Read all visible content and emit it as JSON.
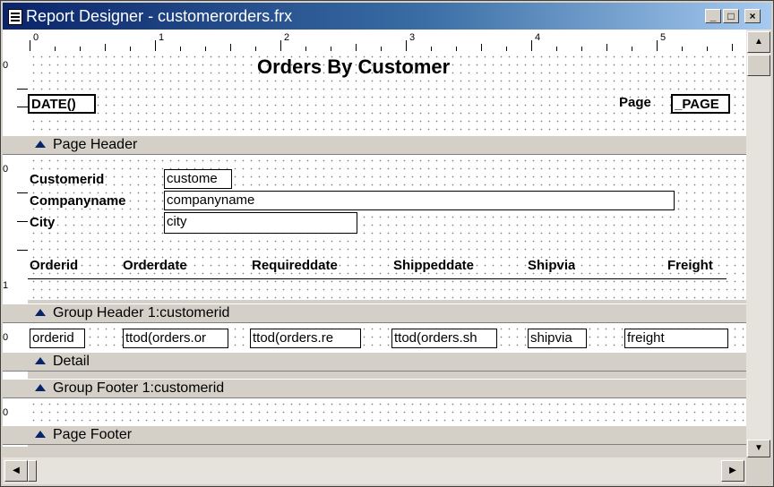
{
  "window": {
    "title": "Report Designer - customerorders.frx",
    "minimize_glyph": "_",
    "maximize_glyph": "□",
    "close_glyph": "×"
  },
  "ruler": {
    "labels": [
      "0",
      "1",
      "2",
      "3",
      "4",
      "5"
    ]
  },
  "vruler": {
    "marks": [
      "0",
      "0",
      "1",
      "0",
      "0"
    ]
  },
  "page_header": {
    "title": "Orders By Customer",
    "date_field": "DATE()",
    "page_label": "Page",
    "page_field": "_PAGE",
    "band_label": "Page Header"
  },
  "group_header": {
    "customerid_label": "Customerid",
    "customerid_field": "custome",
    "companyname_label": "Companyname",
    "companyname_field": "companyname",
    "city_label": "City",
    "city_field": "city",
    "columns": [
      "Orderid",
      "Orderdate",
      "Requireddate",
      "Shippeddate",
      "Shipvia",
      "Freight"
    ],
    "band_label": "Group Header 1:customerid"
  },
  "detail": {
    "fields": [
      "orderid",
      "ttod(orders.or",
      "ttod(orders.re",
      "ttod(orders.sh",
      "shipvia",
      "freight"
    ],
    "band_label": "Detail"
  },
  "group_footer": {
    "band_label": "Group Footer 1:customerid"
  },
  "page_footer": {
    "band_label": "Page Footer"
  },
  "scrollbar": {
    "up_glyph": "▲",
    "down_glyph": "▼",
    "left_glyph": "◀",
    "right_glyph": "▶"
  }
}
